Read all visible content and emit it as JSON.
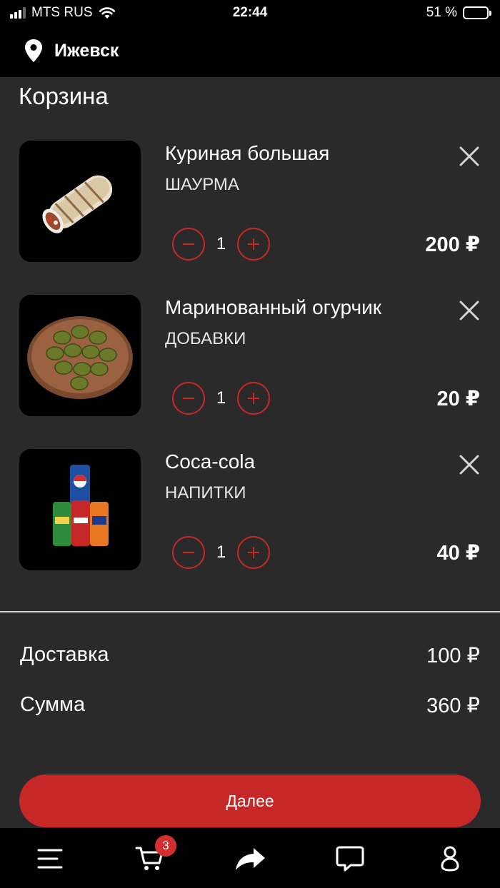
{
  "status_bar": {
    "carrier": "MTS RUS",
    "time": "22:44",
    "battery": "51 %",
    "battery_level": 0.51
  },
  "header": {
    "city": "Ижевск"
  },
  "page": {
    "title": "Корзина"
  },
  "cart": [
    {
      "name": "Куриная большая",
      "category": "ШАУРМА",
      "quantity": "1",
      "price": "200 ₽"
    },
    {
      "name": "Маринованный огурчик",
      "category": "ДОБАВКИ",
      "quantity": "1",
      "price": "20 ₽"
    },
    {
      "name": "Coca-cola",
      "category": "НАПИТКИ",
      "quantity": "1",
      "price": "40 ₽"
    }
  ],
  "summary": {
    "delivery_label": "Доставка",
    "delivery_value": "100 ₽",
    "total_label": "Сумма",
    "total_value": "360 ₽"
  },
  "next_button": "Далее",
  "tab_bar": {
    "items": [
      "menu-icon",
      "cart-icon",
      "share-icon",
      "chat-icon",
      "profile-icon"
    ],
    "cart_badge": "3"
  },
  "colors": {
    "accent": "#c62828",
    "background": "#2a2a2a",
    "bar": "#000000"
  }
}
